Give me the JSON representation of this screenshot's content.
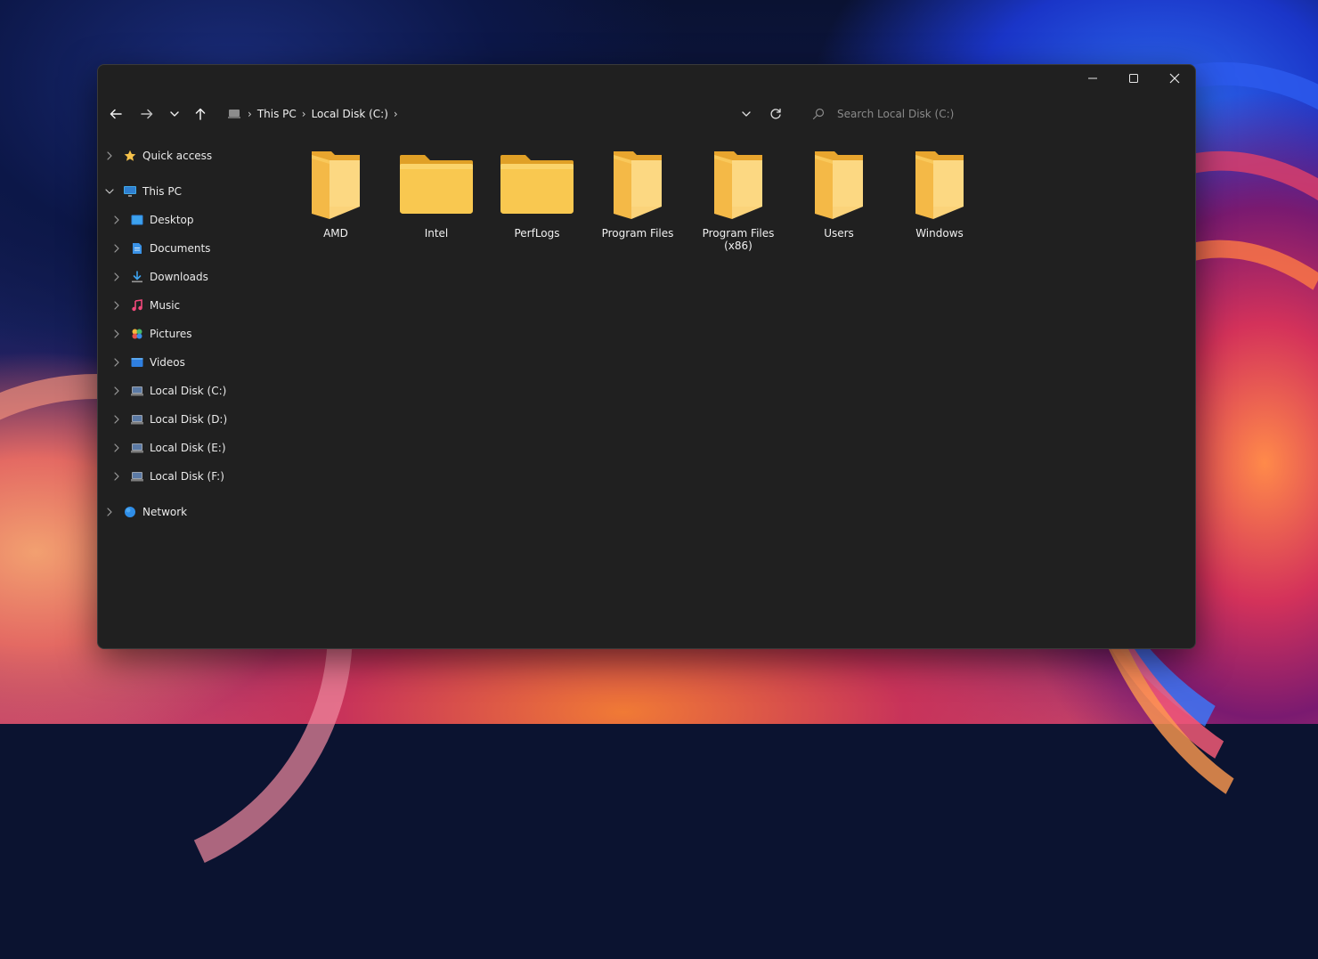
{
  "window": {
    "controls": {
      "minimize": "minimize",
      "maximize": "maximize",
      "close": "close"
    }
  },
  "toolbar": {
    "breadcrumb": [
      "This PC",
      "Local Disk (C:)"
    ],
    "search_placeholder": "Search Local Disk (C:)"
  },
  "sidebar": {
    "quick_access": "Quick access",
    "this_pc": "This PC",
    "items": [
      {
        "label": "Desktop",
        "icon": "desktop-icon"
      },
      {
        "label": "Documents",
        "icon": "documents-icon"
      },
      {
        "label": "Downloads",
        "icon": "downloads-icon"
      },
      {
        "label": "Music",
        "icon": "music-icon"
      },
      {
        "label": "Pictures",
        "icon": "pictures-icon"
      },
      {
        "label": "Videos",
        "icon": "videos-icon"
      },
      {
        "label": "Local Disk (C:)",
        "icon": "drive-icon"
      },
      {
        "label": "Local Disk (D:)",
        "icon": "drive-icon"
      },
      {
        "label": "Local Disk (E:)",
        "icon": "drive-icon"
      },
      {
        "label": "Local Disk (F:)",
        "icon": "drive-icon"
      }
    ],
    "network": "Network"
  },
  "folders": [
    {
      "name": "AMD",
      "style": "open"
    },
    {
      "name": "Intel",
      "style": "closed"
    },
    {
      "name": "PerfLogs",
      "style": "closed"
    },
    {
      "name": "Program Files",
      "style": "open"
    },
    {
      "name": "Program Files (x86)",
      "style": "open"
    },
    {
      "name": "Users",
      "style": "open"
    },
    {
      "name": "Windows",
      "style": "open"
    }
  ],
  "colors": {
    "window_bg": "#202020",
    "folder_yellow": "#f9c85a",
    "folder_dark": "#e2a42a"
  }
}
